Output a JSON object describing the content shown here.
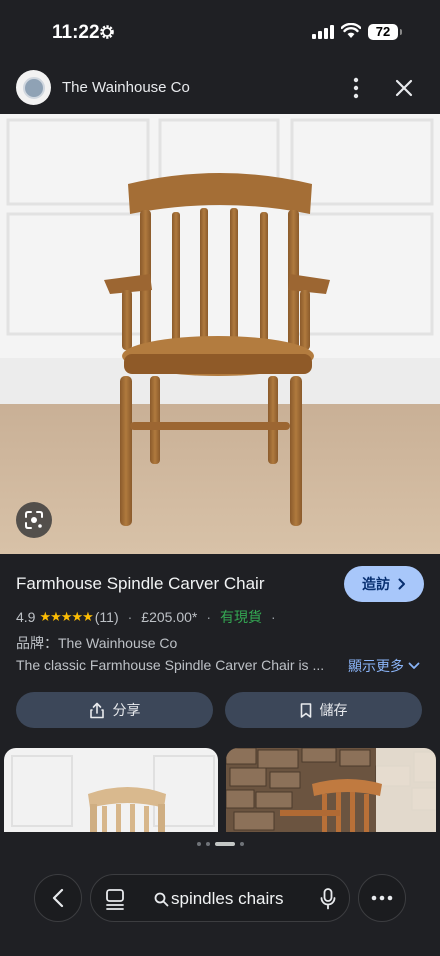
{
  "status_bar": {
    "time": "11:22",
    "battery": "72",
    "icons": [
      "settings-gear-icon",
      "cellular-signal-icon",
      "wifi-icon",
      "battery-icon"
    ]
  },
  "header": {
    "site_name": "The Wainhouse Co",
    "icons": [
      "site-logo",
      "more-vert-icon",
      "close-icon"
    ]
  },
  "product": {
    "title": "Farmhouse Spindle Carver Chair",
    "visit_label": "造訪",
    "rating": "4.9",
    "stars": "★★★★★",
    "review_count": "(11)",
    "price": "£205.00*",
    "stock": "有現貨",
    "brand_line": "品牌：The Wainhouse Co",
    "description": "The classic Farmhouse Spindle Carver Chair is ...",
    "show_more_label": "顯示更多",
    "image_icon": "google-lens-icon"
  },
  "actions": {
    "share_label": "分享",
    "save_label": "儲存"
  },
  "carousel": {
    "page_count": 4,
    "active_page": 3
  },
  "bottom_bar": {
    "search_query": "spindles chairs",
    "icons": [
      "back-icon",
      "tabs-icon",
      "search-icon",
      "mic-icon",
      "more-horiz-icon"
    ]
  },
  "colors": {
    "background": "#1f2024",
    "accent_button": "#a8c7fa",
    "stars": "#fbbc04",
    "in_stock": "#34a853",
    "link": "#8ab4f8",
    "secondary_button": "#3c4759"
  }
}
